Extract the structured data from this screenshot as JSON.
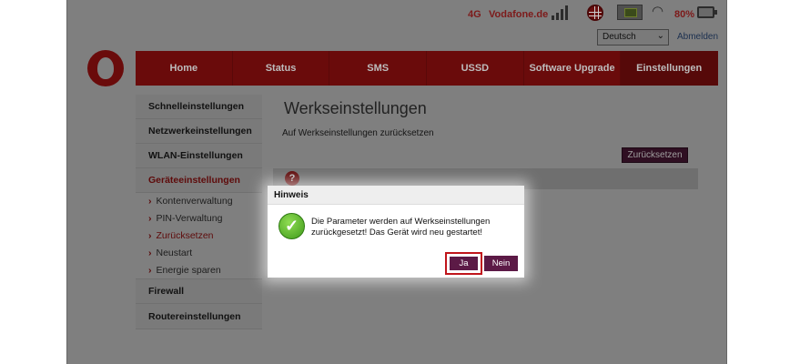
{
  "statusbar": {
    "network_type": "4G",
    "operator": "Vodafone.de",
    "signal_icon": "signal-bars-icon",
    "internet_icon": "globe-icon",
    "sim_icon": "sim-card-icon",
    "wifi_icon": "wifi-icon",
    "battery_percent": "80%",
    "battery_icon": "battery-icon"
  },
  "header": {
    "language": "Deutsch",
    "logout": "Abmelden"
  },
  "nav": {
    "tabs": [
      {
        "label": "Home"
      },
      {
        "label": "Status"
      },
      {
        "label": "SMS"
      },
      {
        "label": "USSD"
      },
      {
        "label": "Software Upgrade"
      },
      {
        "label": "Einstellungen"
      }
    ],
    "active": "Einstellungen"
  },
  "sidebar": {
    "items": [
      {
        "label": "Schnelleinstellungen"
      },
      {
        "label": "Netzwerkeinstellungen"
      },
      {
        "label": "WLAN-Einstellungen"
      },
      {
        "label": "Geräteeinstellungen"
      },
      {
        "label": "Kontenverwaltung"
      },
      {
        "label": "PIN-Verwaltung"
      },
      {
        "label": "Zurücksetzen"
      },
      {
        "label": "Neustart"
      },
      {
        "label": "Energie sparen"
      },
      {
        "label": "Firewall"
      },
      {
        "label": "Routereinstellungen"
      }
    ]
  },
  "main": {
    "title": "Werkseinstellungen",
    "subtitle": "Auf Werkseinstellungen zurücksetzen",
    "reset_button": "Zurücksetzen",
    "info_icon": "?"
  },
  "dialog": {
    "title": "Hinweis",
    "message": "Die Parameter werden auf Werkseinstellungen zurückgesetzt! Das Gerät wird neu gestartet!",
    "yes": "Ja",
    "no": "Nein"
  },
  "colors": {
    "brand_red": "#e60000",
    "dialog_button": "#5c1a46",
    "highlight": "#c0151b"
  }
}
